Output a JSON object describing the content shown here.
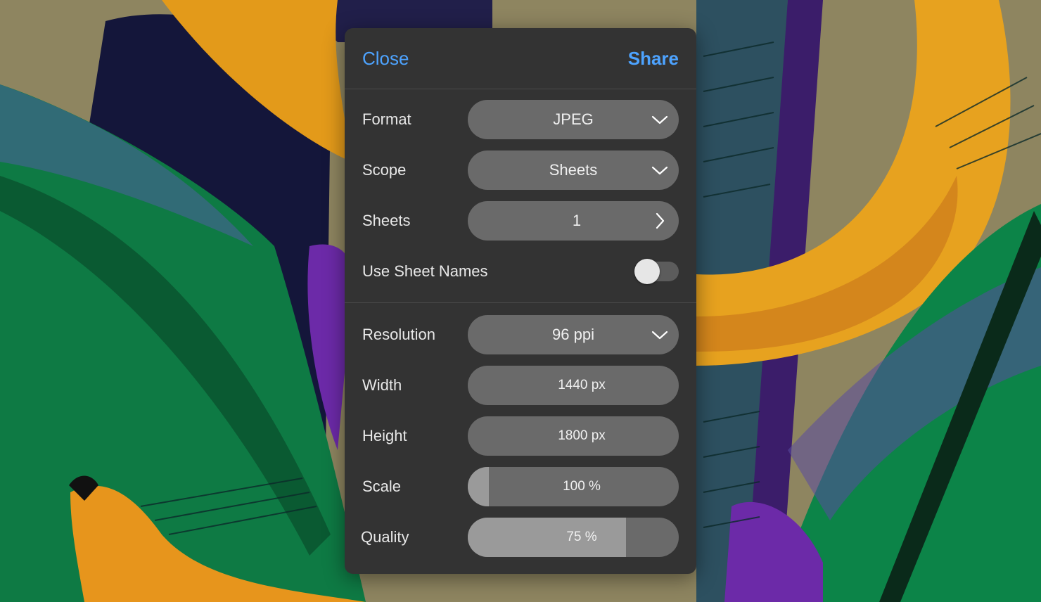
{
  "colors": {
    "accent": "#4da3ff",
    "panel": "#333333",
    "control": "#6a6a6a",
    "fill": "#9a9a9a"
  },
  "header": {
    "close_label": "Close",
    "share_label": "Share"
  },
  "settings": {
    "format": {
      "label": "Format",
      "value": "JPEG",
      "icon": "chevron-down-icon"
    },
    "scope": {
      "label": "Scope",
      "value": "Sheets",
      "icon": "chevron-down-icon"
    },
    "sheets": {
      "label": "Sheets",
      "value": "1",
      "icon": "chevron-right-icon"
    },
    "use_sheet_names": {
      "label": "Use Sheet Names",
      "enabled": false
    },
    "resolution": {
      "label": "Resolution",
      "value": "96 ppi",
      "icon": "chevron-down-icon"
    },
    "width": {
      "label": "Width",
      "value": "1440 px"
    },
    "height": {
      "label": "Height",
      "value": "1800 px"
    },
    "scale": {
      "label": "Scale",
      "value": "100 %",
      "level": 0.1
    },
    "quality": {
      "label": "Quality",
      "value": "75 %",
      "level": 0.75
    }
  }
}
